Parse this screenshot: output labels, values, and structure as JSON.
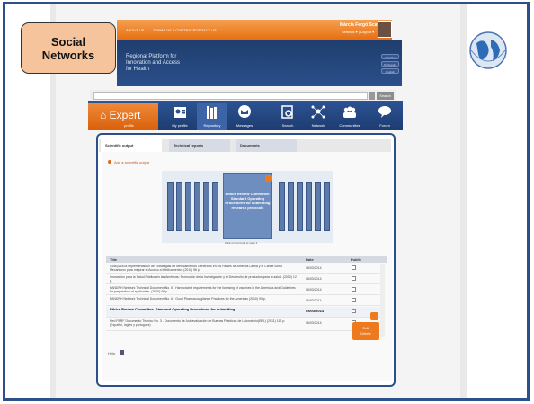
{
  "callout": {
    "line1": "Social",
    "line2": "Networks"
  },
  "top_links": [
    "ABOUT US",
    "TERMS OF A CONTRACT",
    "CONTACT US"
  ],
  "user": {
    "name": "Márcia Fergó Scavone",
    "sub": "Settings ▾  |  Logout ▾"
  },
  "header": {
    "line1": "Regional Platform for",
    "line2": "Innovation and Access",
    "line3": "for Health",
    "buttons": [
      "Español",
      "Português",
      "English"
    ]
  },
  "search": {
    "button": "Search"
  },
  "nav": {
    "brand": "Expert",
    "brand_sub": "profile",
    "items": [
      {
        "label": "My profile",
        "icon": "profile-icon"
      },
      {
        "label": "Repository",
        "icon": "repository-icon"
      },
      {
        "label": "Messages",
        "icon": "messages-icon"
      },
      {
        "label": "Search",
        "icon": "search-icon"
      },
      {
        "label": "Network",
        "icon": "network-icon"
      },
      {
        "label": "Communities",
        "icon": "communities-icon"
      },
      {
        "label": "Forum",
        "icon": "forum-icon"
      }
    ]
  },
  "tabs": [
    "Scientific output",
    "Technical reports",
    "Documents"
  ],
  "add_link": "Add a scientific output",
  "book_title": "Ethics Review Committee. Standard Operating Procedures for submitting research protocols",
  "shelf_caption": "Click on the book to open it",
  "table": {
    "headers": [
      "Title",
      "Date",
      "Public"
    ],
    "rows": [
      {
        "title": "Guía para la Implementación de Estrategias de Medicamentos Genéricos en los Países de América Latina y el Caribe como Mecanismo para mejorar el Acceso a Medicamentos (2011) 96 p.",
        "date": "06/03/2014"
      },
      {
        "title": "Innovación para la Salud Pública en las Américas: Promoción de la Investigación y el Desarrollo de productos para la salud. (2010) 12 p.",
        "date": "06/03/2014"
      },
      {
        "title": "PANDRH Network Technical Document No. 5 - Harmonized requirements for the licensing of vaccines in the Americas and Guidelines for preparation of application. (2010) 96 p.",
        "date": "06/03/2014"
      },
      {
        "title": "PANDRH Network Technical Document No. 6 - Good Pharmacovigilance Practices for the Americas (2010) 90 p.",
        "date": "06/03/2014"
      },
      {
        "title": "Ethics Review Committee. Standard Operating Procedures for submitting...",
        "date": "05/03/2014"
      },
      {
        "title": "Red PARF Documento Técnico No. 3 - Documento de Autoevaluación de Buenas Prácticas de Laboratorio(BPL) (2011) 112 p. (Español, Inglés y portugués)",
        "date": "06/03/2014"
      }
    ]
  },
  "popup": {
    "line1": "Edit",
    "line2": "Delete"
  },
  "help": "Help"
}
